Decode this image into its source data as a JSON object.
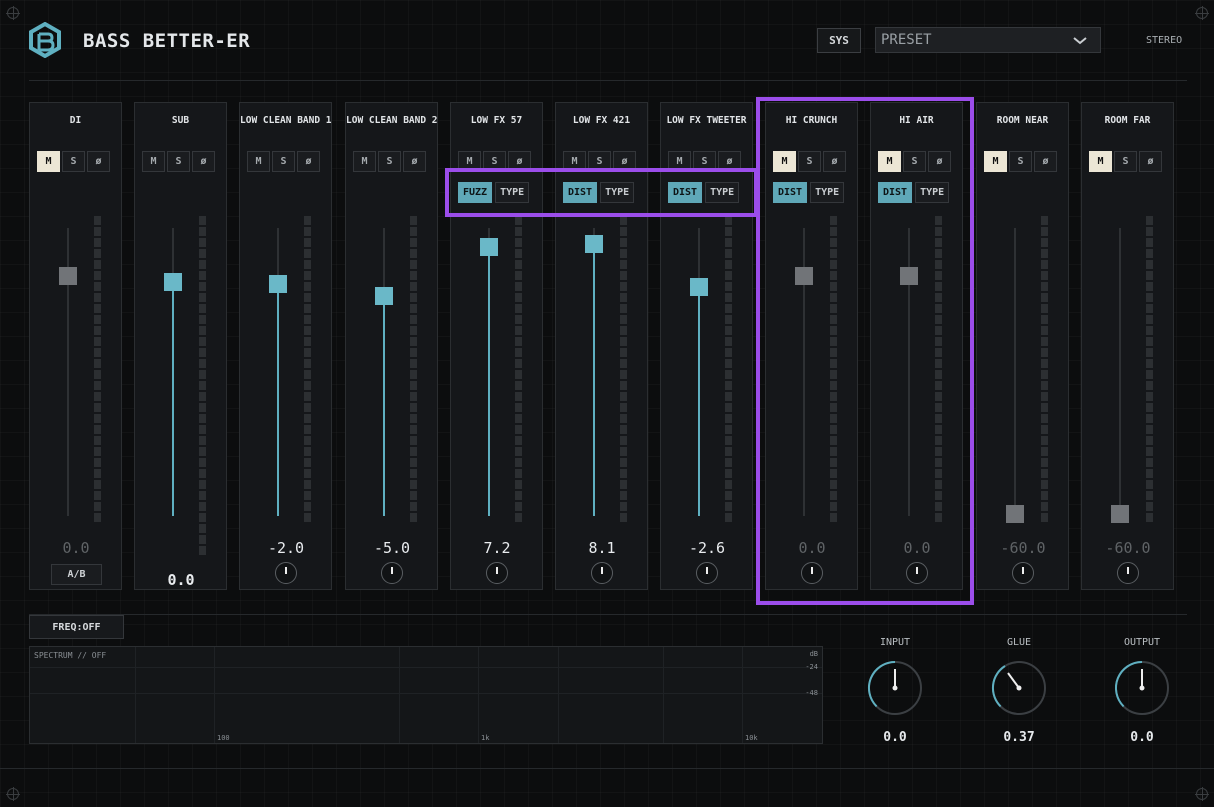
{
  "header": {
    "title": "BASS BETTER-ER",
    "sys_label": "SYS",
    "preset_label": "PRESET",
    "output_mode": "STEREO"
  },
  "strips": [
    {
      "name": "DI",
      "m": "M",
      "s": "S",
      "phase": "ø",
      "value": "0.0",
      "ab": "A/B"
    },
    {
      "name": "SUB",
      "m": "M",
      "s": "S",
      "phase": "ø",
      "value": "0.0"
    },
    {
      "name": "LOW CLEAN BAND 1",
      "m": "M",
      "s": "S",
      "phase": "ø",
      "value": "-2.0"
    },
    {
      "name": "LOW CLEAN BAND 2",
      "m": "M",
      "s": "S",
      "phase": "ø",
      "value": "-5.0"
    },
    {
      "name": "LOW FX 57",
      "m": "M",
      "s": "S",
      "phase": "ø",
      "value": "7.2",
      "fx": "FUZZ",
      "type": "TYPE"
    },
    {
      "name": "LOW FX 421",
      "m": "M",
      "s": "S",
      "phase": "ø",
      "value": "8.1",
      "fx": "DIST",
      "type": "TYPE"
    },
    {
      "name": "LOW FX TWEETER",
      "m": "M",
      "s": "S",
      "phase": "ø",
      "value": "-2.6",
      "fx": "DIST",
      "type": "TYPE"
    },
    {
      "name": "HI CRUNCH",
      "m": "M",
      "s": "S",
      "phase": "ø",
      "value": "0.0",
      "fx": "DIST",
      "type": "TYPE"
    },
    {
      "name": "HI AIR",
      "m": "M",
      "s": "S",
      "phase": "ø",
      "value": "0.0",
      "fx": "DIST",
      "type": "TYPE"
    },
    {
      "name": "ROOM NEAR",
      "m": "M",
      "s": "S",
      "phase": "ø",
      "value": "-60.0"
    },
    {
      "name": "ROOM FAR",
      "m": "M",
      "s": "S",
      "phase": "ø",
      "value": "-60.0"
    }
  ],
  "spectrum": {
    "freq_button": "FREQ:OFF",
    "label": "SPECTRUM // OFF",
    "db_unit": "dB",
    "db_ticks": [
      "-24",
      "-48"
    ],
    "freq_ticks": [
      "100",
      "1k",
      "10k"
    ]
  },
  "globals": [
    {
      "label": "INPUT",
      "value": "0.0"
    },
    {
      "label": "GLUE",
      "value": "0.37"
    },
    {
      "label": "OUTPUT",
      "value": "0.0"
    }
  ],
  "colors": {
    "accent": "#6ab8c8",
    "highlight": "#9b4dea",
    "active_button": "#ece6d5"
  }
}
